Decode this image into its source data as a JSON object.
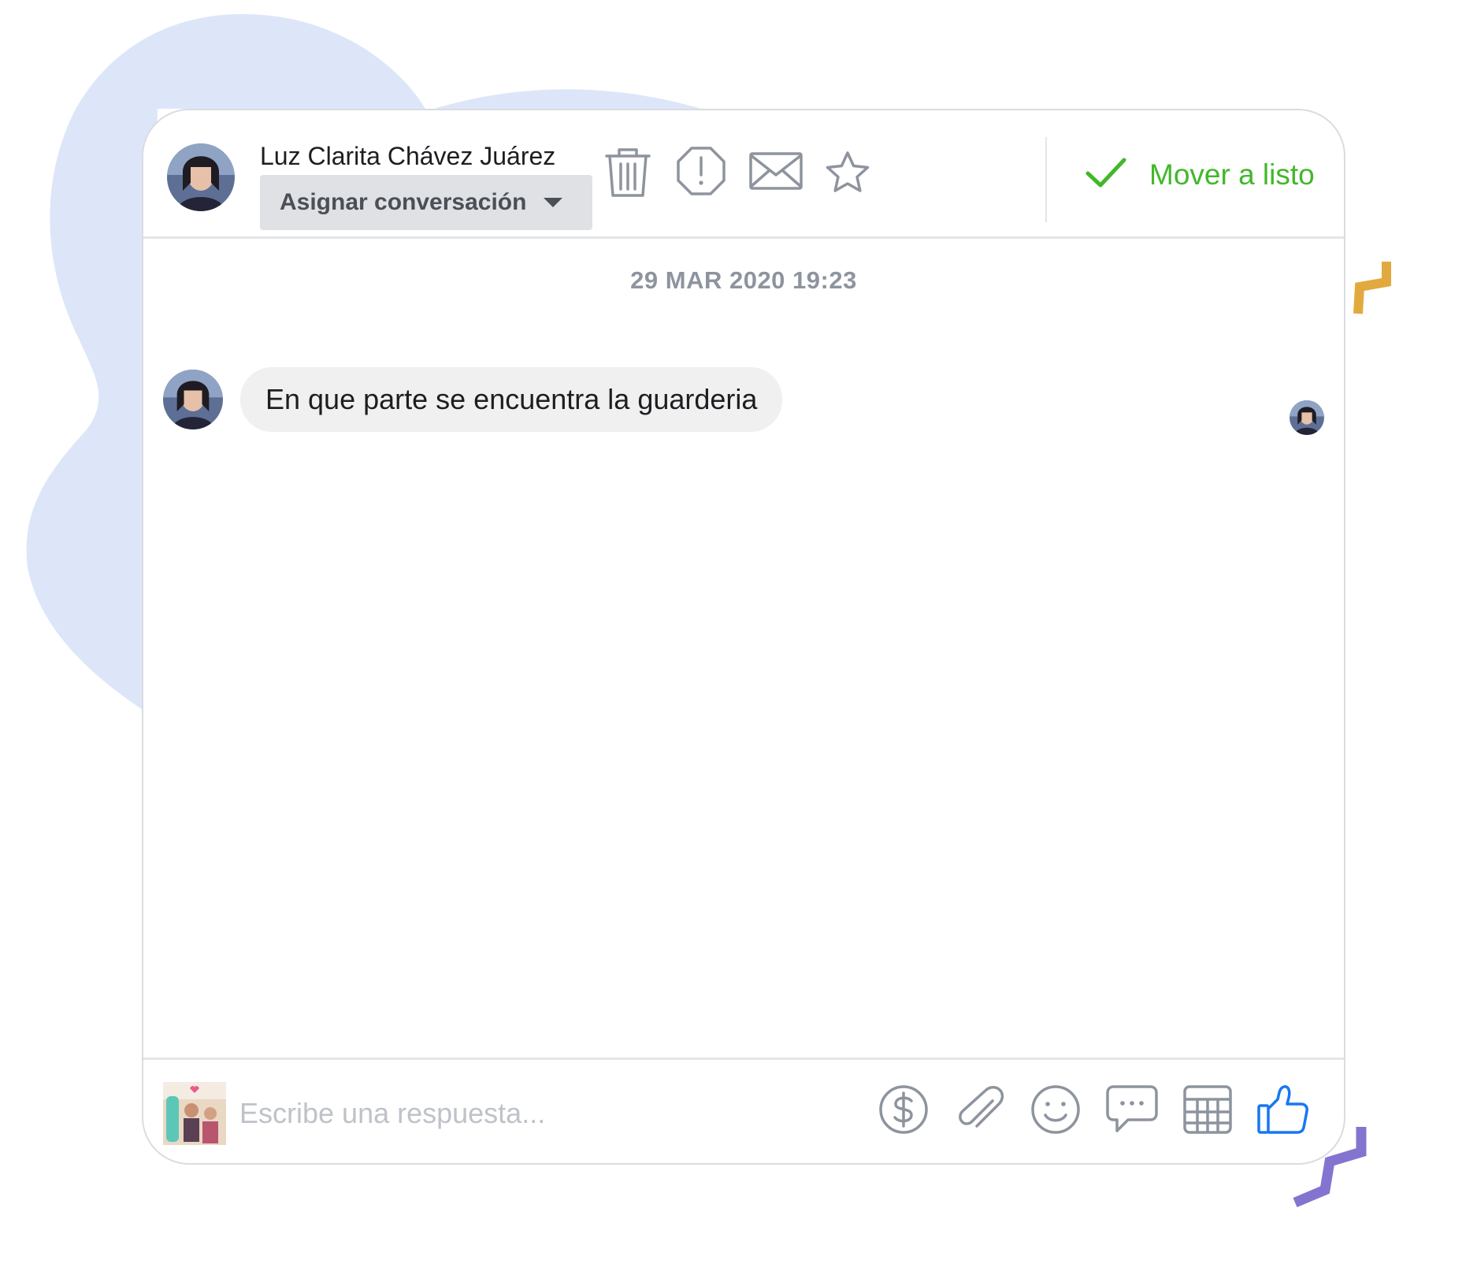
{
  "conversation": {
    "contact_name": "Luz Clarita Chávez Juárez",
    "assign_label": "Asignar conversación",
    "move_done_label": "Mover a listo"
  },
  "header_icons": [
    "trash-icon",
    "spam-icon",
    "mail-icon",
    "star-icon",
    "check-icon"
  ],
  "timestamp": "29 MAR 2020 19:23",
  "messages": [
    {
      "sender": "contact",
      "text": "En que parte se encuentra la guarderia"
    }
  ],
  "composer": {
    "placeholder": "Escribe una respuesta...",
    "icons": [
      "dollar-icon",
      "paperclip-icon",
      "emoji-icon",
      "chat-bubble-icon",
      "table-icon",
      "thumbs-up-icon"
    ]
  },
  "colors": {
    "accent_green": "#42b72a",
    "like_blue": "#1877f2",
    "icon_gray": "#8d949e",
    "bubble_bg": "#f0f0f0",
    "blob": "#dde6f9",
    "deco_orange": "#e2a93e",
    "deco_purple": "#8474d0"
  }
}
